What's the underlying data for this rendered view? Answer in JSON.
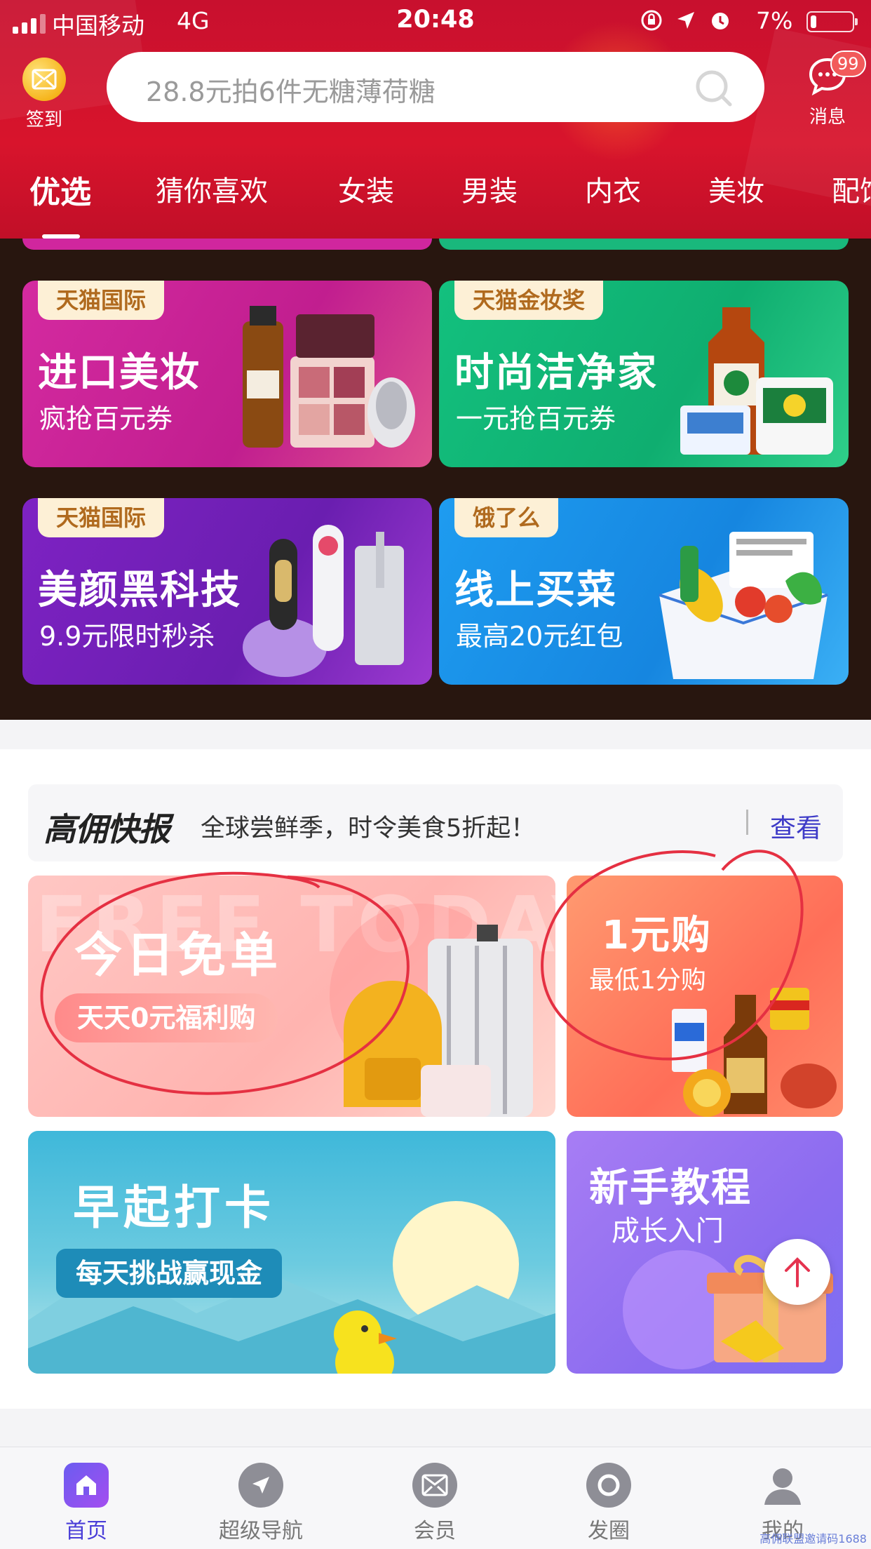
{
  "status_bar": {
    "carrier": "中国移动",
    "network": "4G",
    "time": "20:48",
    "battery": "7%"
  },
  "header": {
    "signin_label": "签到",
    "search_placeholder": "28.8元拍6件无糖薄荷糖",
    "messages_label": "消息",
    "messages_badge": "99",
    "tabs": [
      {
        "label": "优选",
        "active": true
      },
      {
        "label": "猜你喜欢",
        "active": false
      },
      {
        "label": "女装",
        "active": false
      },
      {
        "label": "男装",
        "active": false
      },
      {
        "label": "内衣",
        "active": false
      },
      {
        "label": "美妆",
        "active": false
      },
      {
        "label": "配饰",
        "active": false
      }
    ]
  },
  "promos": [
    {
      "tag": "天猫国际",
      "title": "进口美妆",
      "subtitle": "疯抢百元券",
      "color": "#d0269e"
    },
    {
      "tag": "天猫金妆奖",
      "title": "时尚洁净家",
      "subtitle": "一元抢百元券",
      "color": "#19b87c"
    },
    {
      "tag": "天猫国际",
      "title": "美颜黑科技",
      "subtitle": "9.9元限时秒杀",
      "color": "#7b2bbf"
    },
    {
      "tag": "饿了么",
      "title": "线上买菜",
      "subtitle": "最高20元红包",
      "color": "#1a8fe8"
    }
  ],
  "news": {
    "logo": "高佣快报",
    "text": "全球尝鲜季，时令美食5折起！",
    "more": "查看"
  },
  "features": {
    "free_today": {
      "title": "今日免单",
      "subtitle": "天天0元福利购",
      "watermark": "FREE TODAY"
    },
    "one_yuan": {
      "title": "1元购",
      "subtitle": "最低1分购"
    },
    "checkin": {
      "title": "早起打卡",
      "subtitle": "每天挑战赢现金"
    },
    "tutorial": {
      "title": "新手教程",
      "subtitle": "成长入门"
    }
  },
  "bottom_nav": [
    {
      "label": "首页",
      "icon": "home-icon",
      "active": true
    },
    {
      "label": "超级导航",
      "icon": "navigation-icon",
      "active": false
    },
    {
      "label": "会员",
      "icon": "member-icon",
      "active": false
    },
    {
      "label": "发圈",
      "icon": "moments-icon",
      "active": false
    },
    {
      "label": "我的",
      "icon": "profile-icon",
      "active": false
    }
  ],
  "watermark": "高佣联盟邀请码1688"
}
